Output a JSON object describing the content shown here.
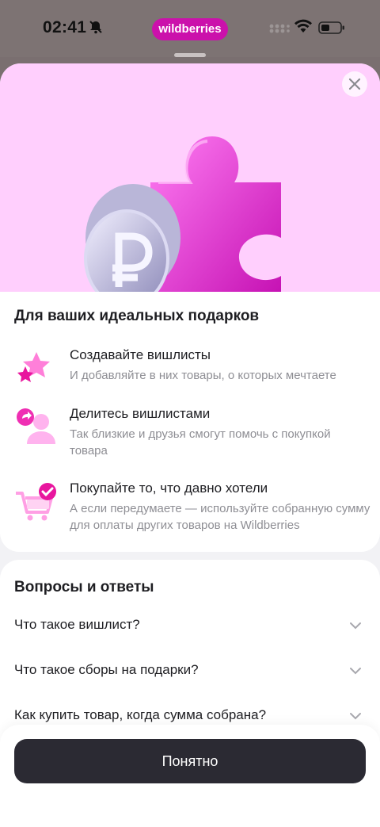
{
  "status_bar": {
    "time": "02:41",
    "app_badge": "wildberries"
  },
  "close_icon": "close-icon",
  "features": {
    "title": "Для ваших идеальных подарков",
    "items": [
      {
        "icon": "stars-icon",
        "title": "Создавайте вишлисты",
        "desc": "И добавляйте в них товары, о которых мечтаете"
      },
      {
        "icon": "share-user-icon",
        "title": "Делитесь вишлистами",
        "desc": "Так близкие и друзья смогут помочь с покупкой товара"
      },
      {
        "icon": "cart-check-icon",
        "title": "Покупайте то, что давно хотели",
        "desc": "А если передумаете — используйте собранную сумму для оплаты других товаров на Wildberries"
      }
    ]
  },
  "faq": {
    "title": "Вопросы и ответы",
    "items": [
      {
        "question": "Что такое вишлист?"
      },
      {
        "question": "Что такое сборы на подарки?"
      },
      {
        "question": "Как купить товар, когда сумма собрана?"
      }
    ]
  },
  "actions": {
    "ok_label": "Понятно"
  },
  "colors": {
    "brand": "#cb11ab",
    "hero_bg": "#ffcffd",
    "button": "#2b2a33"
  }
}
